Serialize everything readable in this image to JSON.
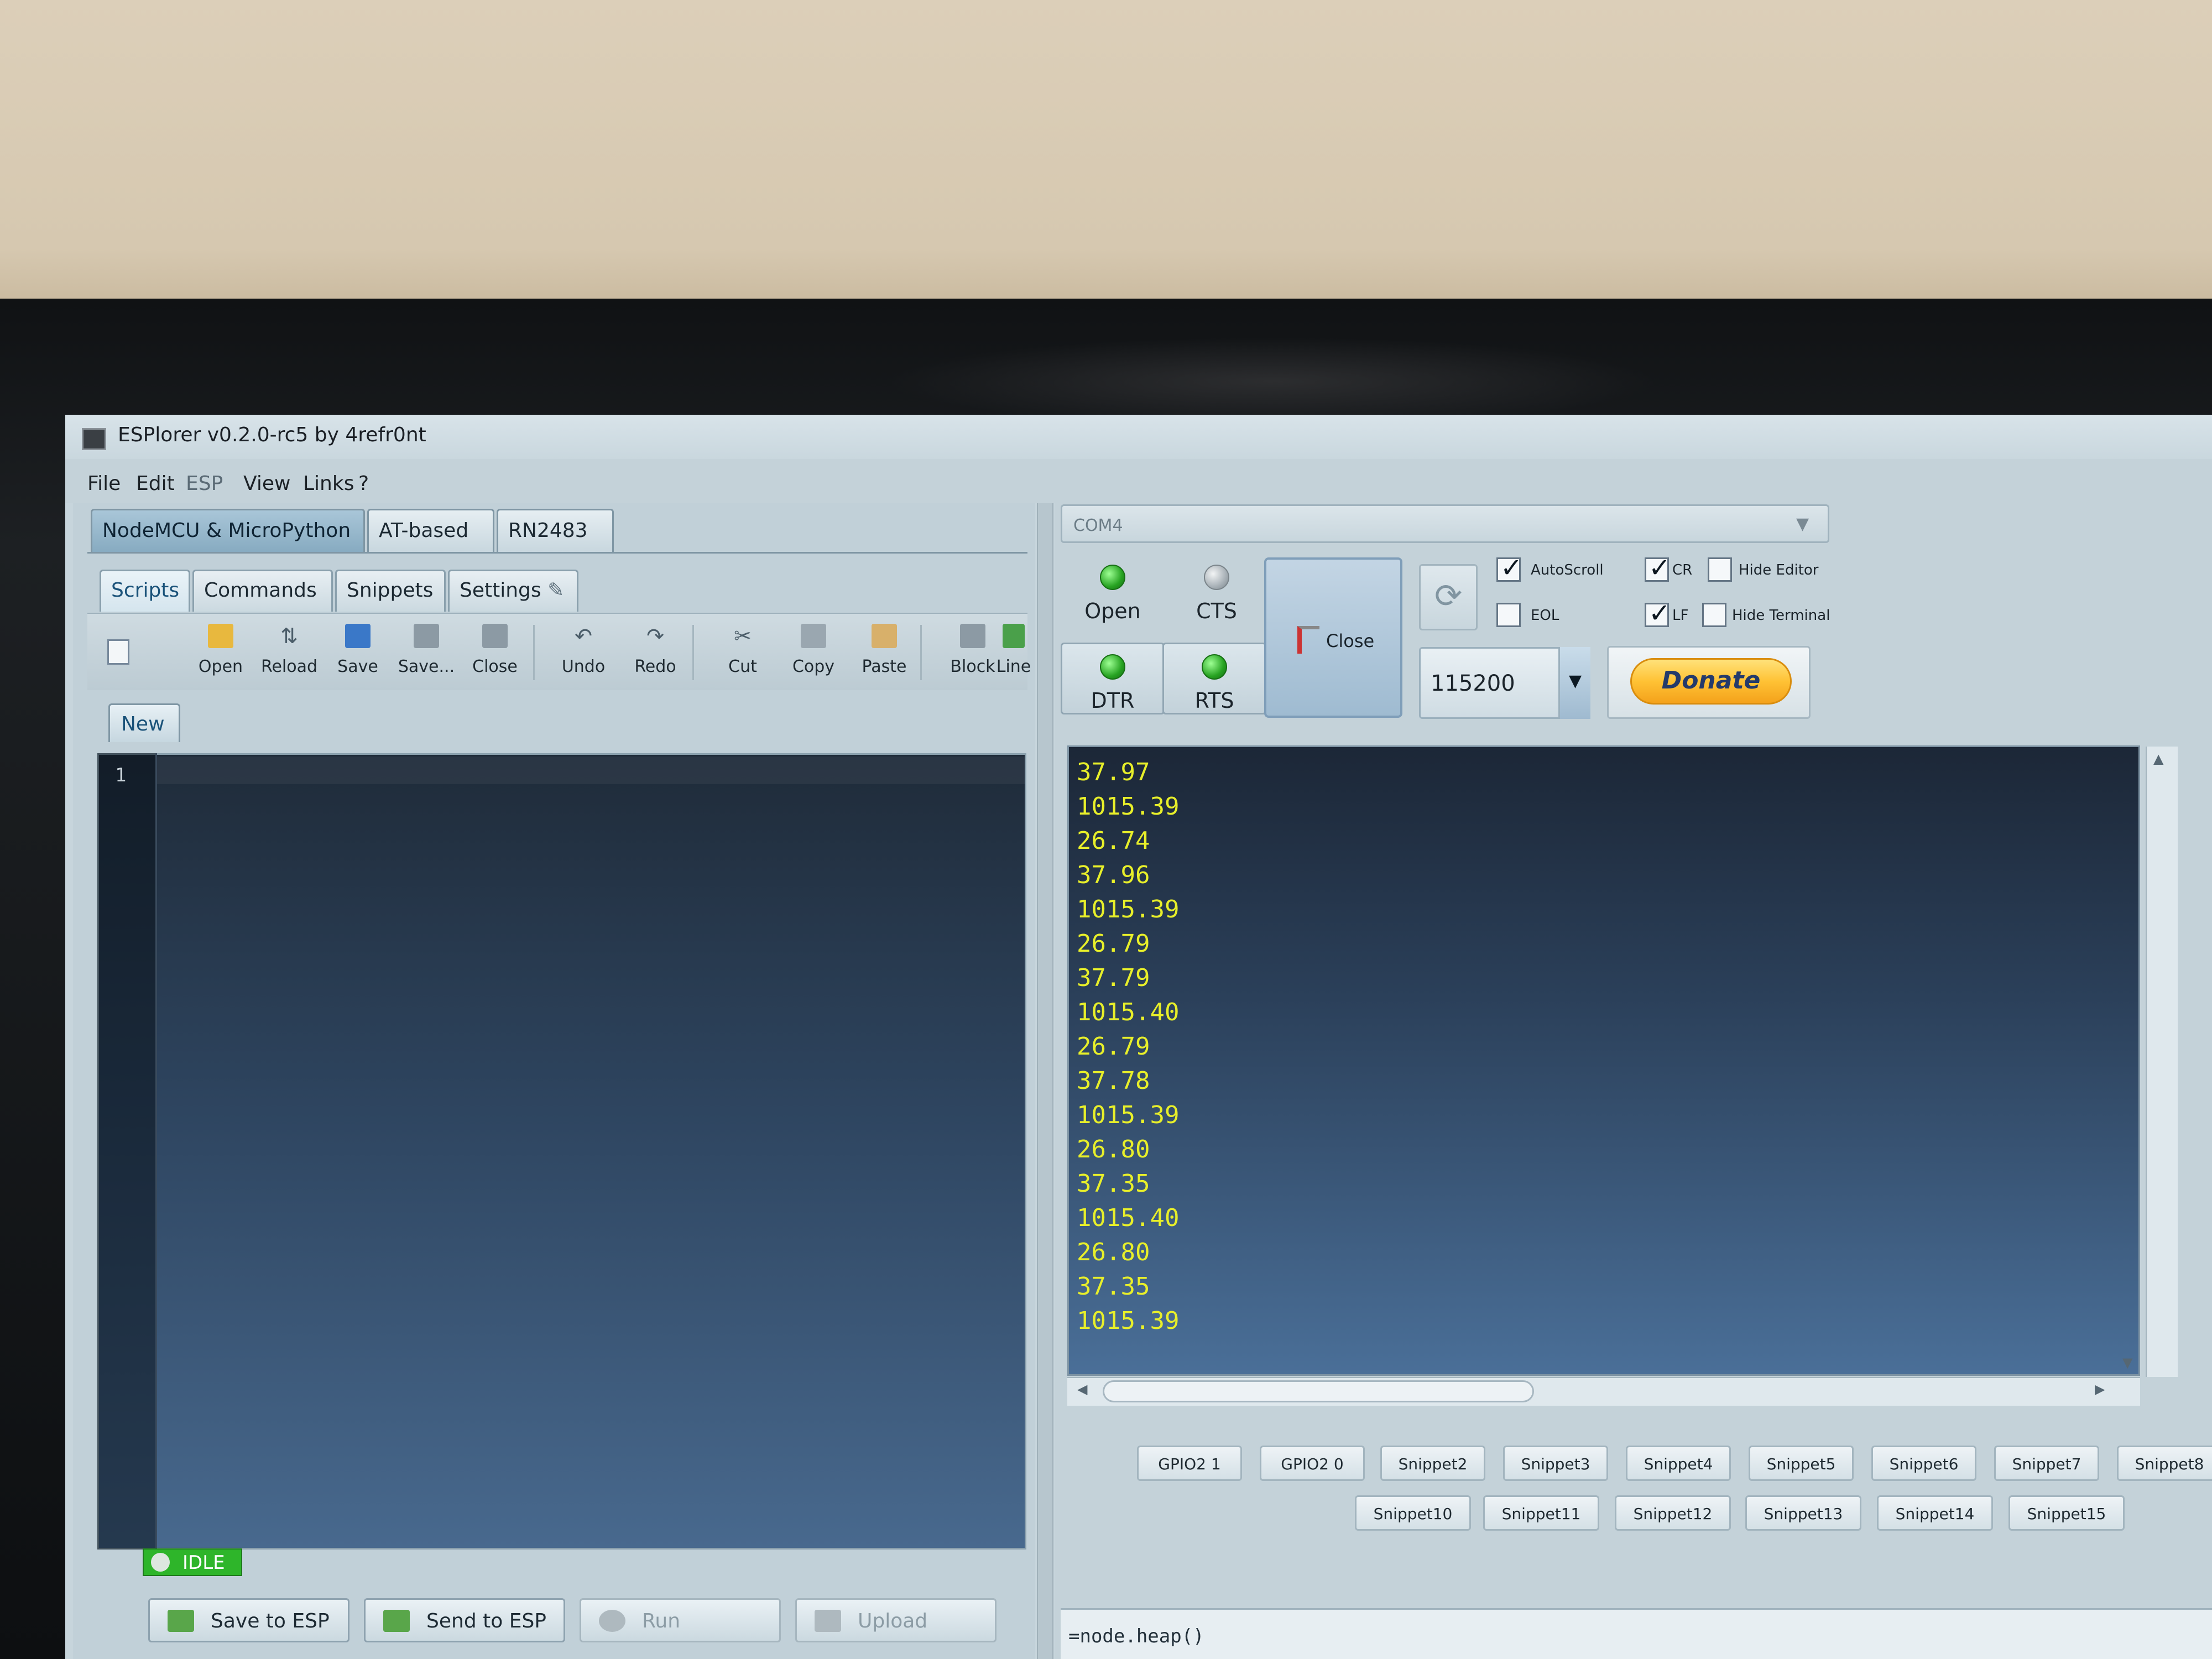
{
  "window": {
    "title": "ESPlorer v0.2.0-rc5 by 4refr0nt"
  },
  "menu": [
    "File",
    "Edit",
    "ESP",
    "View",
    "Links",
    "?"
  ],
  "platform_tabs": [
    "NodeMCU & MicroPython",
    "AT-based",
    "RN2483"
  ],
  "sub_tabs": [
    "Scripts",
    "Commands",
    "Snippets",
    "Settings"
  ],
  "toolbar": [
    "Open",
    "Reload",
    "Save",
    "Save...",
    "Close",
    "Undo",
    "Redo",
    "Cut",
    "Copy",
    "Paste",
    "Block",
    "Line"
  ],
  "file_tab": "New",
  "editor": {
    "line_number": "1"
  },
  "status": "IDLE",
  "bottom_buttons": [
    "Save to ESP",
    "Send to ESP",
    "Run",
    "Upload"
  ],
  "port": "COM4",
  "controls": {
    "open": "Open",
    "cts": "CTS",
    "dtr": "DTR",
    "rts": "RTS",
    "close": "Close"
  },
  "options": {
    "autoscroll": {
      "label": "AutoScroll",
      "checked": true
    },
    "eol": {
      "label": "EOL",
      "checked": false
    },
    "cr": {
      "label": "CR",
      "checked": true
    },
    "lf": {
      "label": "LF",
      "checked": true
    },
    "hide_editor": {
      "label": "Hide Editor",
      "checked": false
    },
    "hide_terminal": {
      "label": "Hide Terminal",
      "checked": false
    }
  },
  "baud": "115200",
  "donate": "Donate",
  "terminal_lines": [
    "37.97",
    "1015.39",
    "26.74",
    "37.96",
    "1015.39",
    "26.79",
    "37.79",
    "1015.40",
    "26.79",
    "37.78",
    "1015.39",
    "26.80",
    "37.35",
    "1015.40",
    "26.80",
    "37.35",
    "1015.39"
  ],
  "snippets_row1": [
    "GPIO2 1",
    "GPIO2 0",
    "Snippet2",
    "Snippet3",
    "Snippet4",
    "Snippet5",
    "Snippet6",
    "Snippet7",
    "Snippet8"
  ],
  "snippets_row2": [
    "Snippet10",
    "Snippet11",
    "Snippet12",
    "Snippet13",
    "Snippet14",
    "Snippet15"
  ],
  "command": "=node.heap()"
}
